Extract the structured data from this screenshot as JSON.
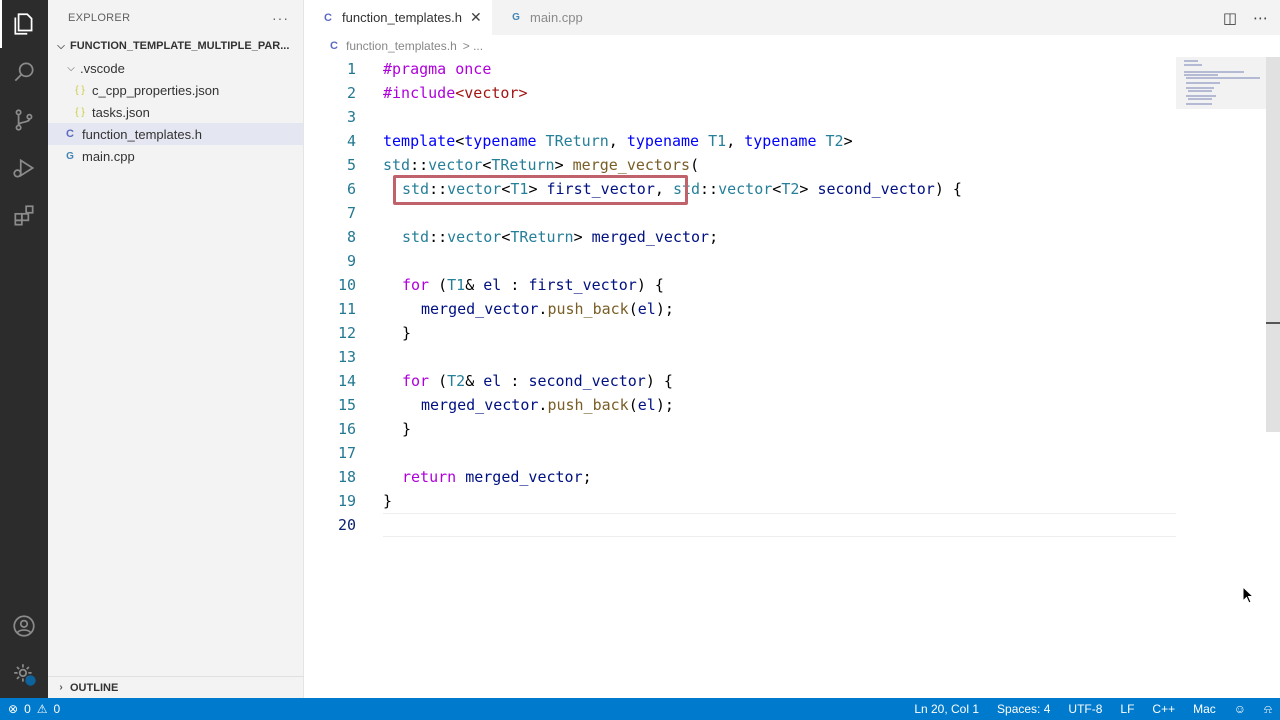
{
  "sidebar": {
    "title": "EXPLORER",
    "more": "···",
    "root": "FUNCTION_TEMPLATE_MULTIPLE_PAR...",
    "items": [
      {
        "label": ".vscode",
        "icon": "chevron-down-icon"
      },
      {
        "label": "c_cpp_properties.json",
        "icon": "json-file-icon",
        "glyph": "{ }"
      },
      {
        "label": "tasks.json",
        "icon": "json-file-icon",
        "glyph": "{ }"
      },
      {
        "label": "function_templates.h",
        "icon": "c-file-icon",
        "glyph": "C"
      },
      {
        "label": "main.cpp",
        "icon": "cpp-file-icon",
        "glyph": "G"
      }
    ],
    "outline": "OUTLINE"
  },
  "tabs": [
    {
      "label": "function_templates.h",
      "glyph": "C",
      "active": true,
      "close": "✕"
    },
    {
      "label": "main.cpp",
      "glyph": "G",
      "active": false
    }
  ],
  "breadcrumb": {
    "file": "function_templates.h",
    "glyph": "C",
    "rest": "> ..."
  },
  "code_lines": [
    {
      "n": "1"
    },
    {
      "n": "2"
    },
    {
      "n": "3"
    },
    {
      "n": "4"
    },
    {
      "n": "5"
    },
    {
      "n": "6"
    },
    {
      "n": "7"
    },
    {
      "n": "8"
    },
    {
      "n": "9"
    },
    {
      "n": "10"
    },
    {
      "n": "11"
    },
    {
      "n": "12"
    },
    {
      "n": "13"
    },
    {
      "n": "14"
    },
    {
      "n": "15"
    },
    {
      "n": "16"
    },
    {
      "n": "17"
    },
    {
      "n": "18"
    },
    {
      "n": "19"
    },
    {
      "n": "20"
    }
  ],
  "code": {
    "l1_a": "#pragma",
    "l1_b": " once",
    "l2_a": "#include",
    "l2_b": "<vector>",
    "l4_a": "template",
    "l4_b": "<",
    "l4_c": "typename",
    "l4_d": " TReturn",
    "l4_e": ", ",
    "l4_f": "typename",
    "l4_g": " T1",
    "l4_h": ", ",
    "l4_i": "typename",
    "l4_j": " T2",
    "l4_k": ">",
    "l5_a": "std",
    "l5_b": "::",
    "l5_c": "vector",
    "l5_d": "<",
    "l5_e": "TReturn",
    "l5_f": "> ",
    "l5_g": "merge_vectors",
    "l5_h": "(",
    "l6_a": "std",
    "l6_b": "::",
    "l6_c": "vector",
    "l6_d": "<",
    "l6_e": "T1",
    "l6_f": "> ",
    "l6_g": "first_vector",
    "l6_h": ", ",
    "l6_i": "std",
    "l6_j": "::",
    "l6_k": "vector",
    "l6_l": "<",
    "l6_m": "T2",
    "l6_n": "> ",
    "l6_o": "second_vector",
    "l6_p": ") {",
    "l8_a": "std",
    "l8_b": "::",
    "l8_c": "vector",
    "l8_d": "<",
    "l8_e": "TReturn",
    "l8_f": "> ",
    "l8_g": "merged_vector",
    "l8_h": ";",
    "l10_a": "for",
    "l10_b": " (",
    "l10_c": "T1",
    "l10_d": "& ",
    "l10_e": "el",
    "l10_f": " : ",
    "l10_g": "first_vector",
    "l10_h": ") {",
    "l11_a": "merged_vector",
    "l11_b": ".",
    "l11_c": "push_back",
    "l11_d": "(",
    "l11_e": "el",
    "l11_f": ");",
    "l12_a": "}",
    "l14_a": "for",
    "l14_b": " (",
    "l14_c": "T2",
    "l14_d": "& ",
    "l14_e": "el",
    "l14_f": " : ",
    "l14_g": "second_vector",
    "l14_h": ") {",
    "l15_a": "merged_vector",
    "l15_b": ".",
    "l15_c": "push_back",
    "l15_d": "(",
    "l15_e": "el",
    "l15_f": ");",
    "l16_a": "}",
    "l18_a": "return",
    "l18_b": " merged_vector",
    "l18_c": ";",
    "l19_a": "}"
  },
  "status": {
    "errors": "0",
    "warnings": "0",
    "position": "Ln 20, Col 1",
    "spaces": "Spaces: 4",
    "encoding": "UTF-8",
    "eol": "LF",
    "language": "C++",
    "platform": "Mac"
  },
  "colors": {
    "keyword_control": "#af00db",
    "keyword": "#0000ff",
    "type": "#267f99",
    "function": "#795e26",
    "string": "#a31515",
    "variable": "#001080",
    "line_number": "#237893",
    "status_bar": "#007acc",
    "highlight_box": "#c0626b"
  }
}
